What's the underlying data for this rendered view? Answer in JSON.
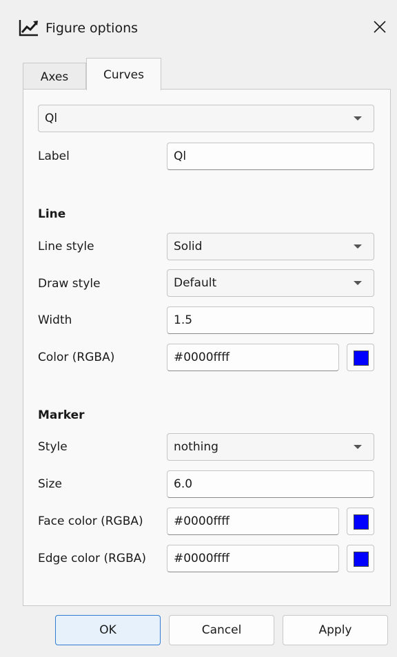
{
  "window": {
    "title": "Figure options",
    "icon": "line-chart-icon",
    "close_icon": "close-icon"
  },
  "tabs": [
    {
      "label": "Axes",
      "active": false
    },
    {
      "label": "Curves",
      "active": true
    }
  ],
  "curve_selector": {
    "value": "Ql"
  },
  "label_row": {
    "label": "Label",
    "value": "Ql"
  },
  "line_section": {
    "heading": "Line",
    "line_style": {
      "label": "Line style",
      "value": "Solid"
    },
    "draw_style": {
      "label": "Draw style",
      "value": "Default"
    },
    "width": {
      "label": "Width",
      "value": "1.5"
    },
    "color": {
      "label": "Color (RGBA)",
      "value": "#0000ffff",
      "swatch": "#0000ff"
    }
  },
  "marker_section": {
    "heading": "Marker",
    "style": {
      "label": "Style",
      "value": "nothing"
    },
    "size": {
      "label": "Size",
      "value": "6.0"
    },
    "face_color": {
      "label": "Face color (RGBA)",
      "value": "#0000ffff",
      "swatch": "#0000ff"
    },
    "edge_color": {
      "label": "Edge color (RGBA)",
      "value": "#0000ffff",
      "swatch": "#0000ff"
    }
  },
  "buttons": {
    "ok": "OK",
    "cancel": "Cancel",
    "apply": "Apply"
  }
}
